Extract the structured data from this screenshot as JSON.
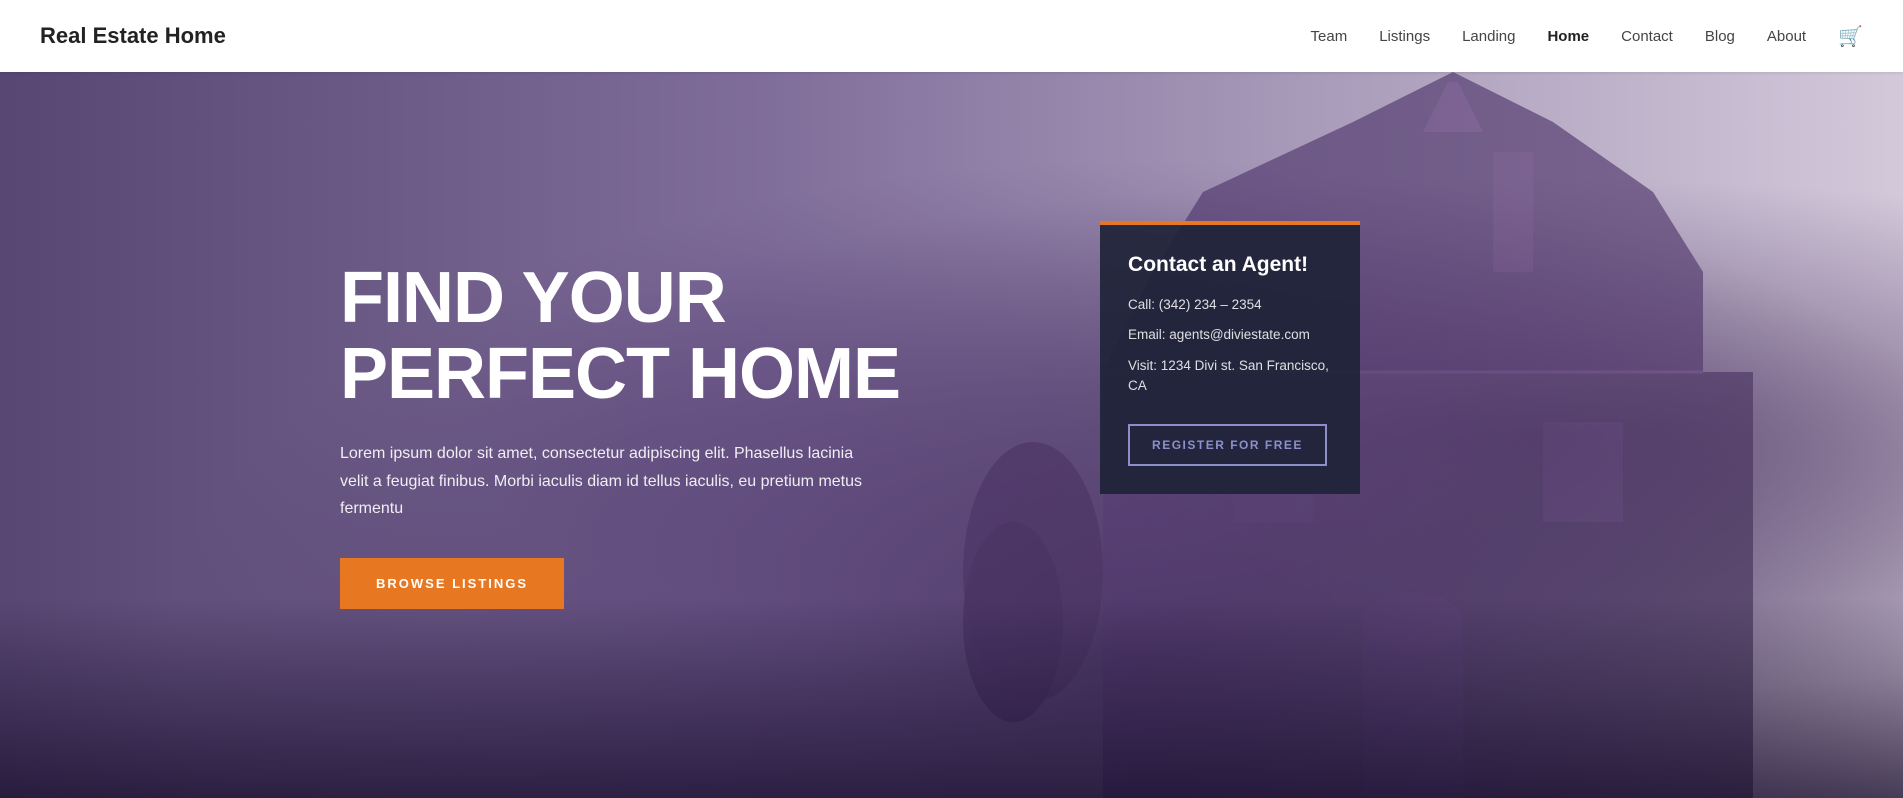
{
  "header": {
    "logo": "Real Estate Home",
    "nav": {
      "items": [
        {
          "id": "team",
          "label": "Team",
          "active": false
        },
        {
          "id": "listings",
          "label": "Listings",
          "active": false
        },
        {
          "id": "landing",
          "label": "Landing",
          "active": false
        },
        {
          "id": "home",
          "label": "Home",
          "active": true
        },
        {
          "id": "contact",
          "label": "Contact",
          "active": false
        },
        {
          "id": "blog",
          "label": "Blog",
          "active": false
        },
        {
          "id": "about",
          "label": "About",
          "active": false
        }
      ],
      "cart_icon": "🛒"
    }
  },
  "hero": {
    "title_line1": "FIND YOUR",
    "title_line2": "PERFECT HOME",
    "description": "Lorem ipsum dolor sit amet, consectetur adipiscing elit. Phasellus lacinia velit a feugiat finibus. Morbi iaculis diam id tellus iaculis, eu pretium metus fermentu",
    "cta_button": "BROWSE LISTINGS",
    "contact_card": {
      "title": "Contact an Agent!",
      "phone_label": "Call: ",
      "phone_value": "(342) 234 – 2354",
      "email_label": "Email: ",
      "email_value": "agents@diviestate.com",
      "visit_label": "Visit: ",
      "visit_value": "1234 Divi st. San Francisco, CA",
      "register_button": "REGISTER FOR FREE"
    }
  }
}
